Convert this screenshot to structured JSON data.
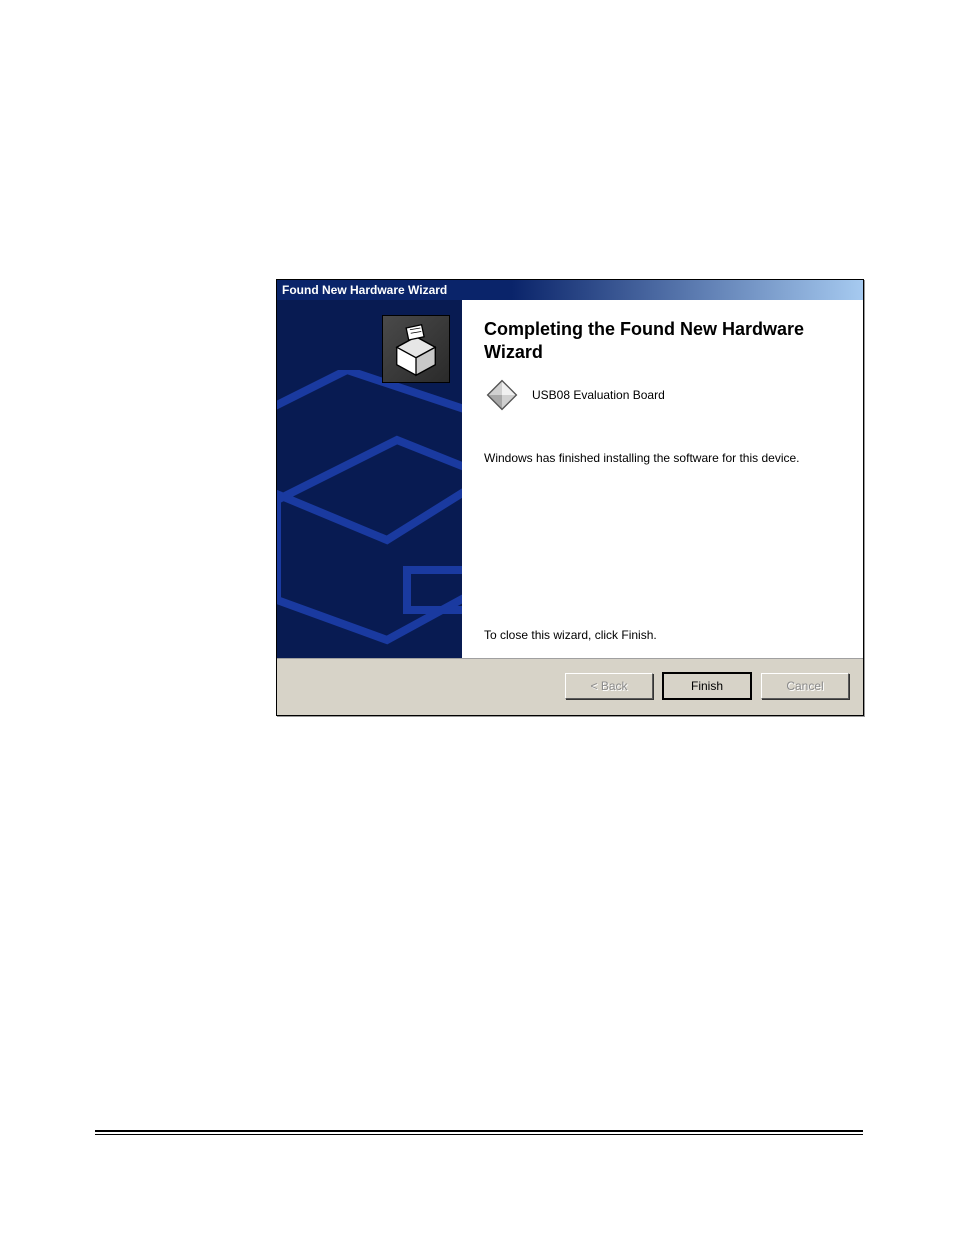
{
  "dialog": {
    "title": "Found New Hardware Wizard",
    "heading": "Completing the Found New Hardware Wizard",
    "device_name": "USB08 Evaluation Board",
    "body_text": "Windows has finished installing the software for this device.",
    "close_hint": "To close this wizard, click Finish.",
    "buttons": {
      "back": "< Back",
      "finish": "Finish",
      "cancel": "Cancel"
    },
    "icons": {
      "sidebar": "install-box-icon",
      "device": "diamond-icon"
    }
  }
}
